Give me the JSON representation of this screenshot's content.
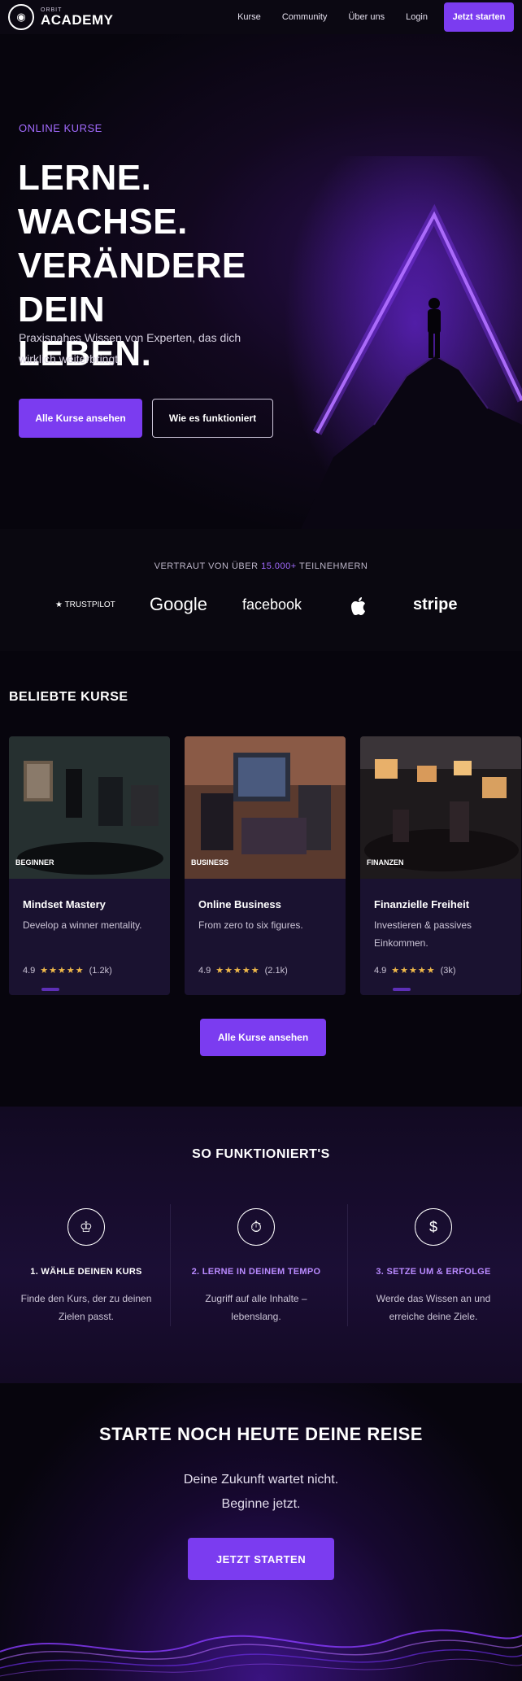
{
  "nav": {
    "logo_top": "ORBIT",
    "logo_main": "ACADEMY",
    "links": [
      "Kurse",
      "Community",
      "Über uns",
      "Login"
    ],
    "cta": "Jetzt starten"
  },
  "hero": {
    "eyebrow": "ONLINE KURSE",
    "title_line1": "LERNE. WACHSE.",
    "title_line2": "VERÄNDERE DEIN",
    "title_line3": "LEBEN.",
    "subtitle": "Praxisnahes Wissen von Experten, das dich wirklich weiterbringt.",
    "btn_primary": "Alle Kurse ansehen",
    "btn_secondary": "Wie es funktioniert"
  },
  "trust": {
    "text_before": "VERTRAUT VON ÜBER",
    "highlight": "15.000+",
    "text_after": "TEILNEHMERN",
    "logos": [
      "★ TRUSTPILOT",
      "Google",
      "facebook",
      "",
      "stripe"
    ]
  },
  "courses": {
    "title": "BELIEBTE KURSE",
    "items": [
      {
        "tag": "BEGINNER",
        "title": "Mindset Mastery",
        "desc": "Develop a winner mentality.",
        "rating": "4.9",
        "stars": "★★★★★",
        "count": "(1.2k)"
      },
      {
        "tag": "BUSINESS",
        "title": "Online Business",
        "desc": "From zero to six figures.",
        "rating": "4.9",
        "stars": "★★★★★",
        "count": "(2.1k)"
      },
      {
        "tag": "FINANZEN",
        "title": "Finanzielle Freiheit",
        "desc": "Investieren & passives Einkommen.",
        "rating": "4.9",
        "stars": "★★★★★",
        "count": "(3k)"
      }
    ],
    "btn_all": "Alle Kurse ansehen"
  },
  "how": {
    "title": "SO FUNKTIONIERT'S",
    "steps": [
      {
        "icon": "course-icon",
        "title": "1. WÄHLE DEINEN KURS",
        "desc": "Finde den Kurs, der zu deinen Zielen passt."
      },
      {
        "icon": "tempo-icon",
        "title": "2. LERNE IN DEINEM TEMPO",
        "desc": "Zugriff auf alle Inhalte – lebenslang."
      },
      {
        "icon": "success-icon",
        "title": "3. SETZE UM & ERFOLGE",
        "desc": "Werde das Wissen an und erreiche deine Ziele."
      }
    ]
  },
  "final": {
    "title": "STARTE NOCH HEUTE DEINE REISE",
    "sub_line1": "Deine Zukunft wartet nicht.",
    "sub_line2": "Beginne jetzt.",
    "cta": "JETZT STARTEN"
  },
  "colors": {
    "accent": "#7b3cf0",
    "accent_light": "#a36bff",
    "bg": "#07050d"
  }
}
